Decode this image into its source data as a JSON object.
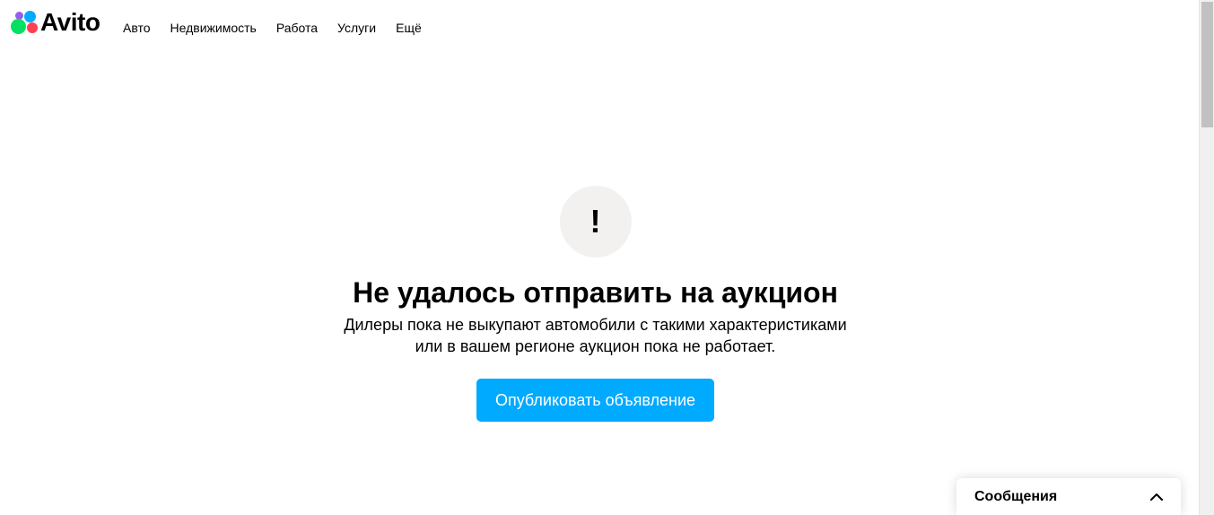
{
  "header": {
    "logo_text": "Avito",
    "nav": [
      {
        "label": "Авто"
      },
      {
        "label": "Недвижимость"
      },
      {
        "label": "Работа"
      },
      {
        "label": "Услуги"
      },
      {
        "label": "Ещё"
      }
    ]
  },
  "main": {
    "icon_glyph": "!",
    "title": "Не удалось отправить на аукцион",
    "description": "Дилеры пока не выкупают автомобили с такими характеристиками или в вашем регионе аукцион пока не работает.",
    "publish_button_label": "Опубликовать объявление"
  },
  "messenger": {
    "label": "Сообщения",
    "icon": "chevron-up-icon"
  },
  "colors": {
    "accent": "#00aaff",
    "icon_bg": "#f2f1f0",
    "logo_green": "#04e061",
    "logo_blue": "#00aaff",
    "logo_purple": "#965eeb",
    "logo_red": "#ff4053"
  }
}
